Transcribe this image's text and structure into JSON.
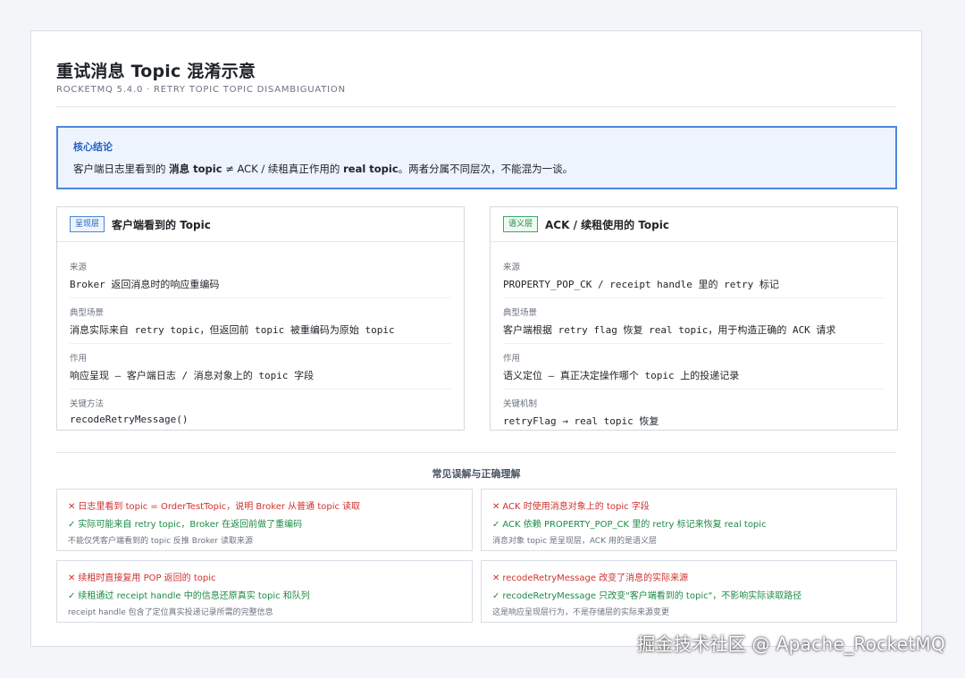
{
  "header": {
    "title": "重试消息 Topic 混淆示意",
    "subtitle": "ROCKETMQ 5.4.0 · RETRY TOPIC TOPIC DISAMBIGUATION"
  },
  "conclusion": {
    "title": "核心结论",
    "text_1": "客户端日志里看到的 ",
    "bold_1": "消息 topic",
    "text_2": " ≠ ACK / 续租真正作用的 ",
    "bold_2": "real topic",
    "text_3": "。两者分属不同层次，不能混为一谈。"
  },
  "layers": [
    {
      "tag": "呈现层",
      "title": "客户端看到的 Topic",
      "fields": [
        {
          "label": "来源",
          "value": "Broker 返回消息时的响应重编码"
        },
        {
          "label": "典型场景",
          "value": "消息实际来自 retry topic，但返回前 topic 被重编码为原始 topic"
        },
        {
          "label": "作用",
          "value": "响应呈现 — 客户端日志 / 消息对象上的 topic 字段"
        },
        {
          "label": "关键方法",
          "value": "recodeRetryMessage()"
        }
      ]
    },
    {
      "tag": "语义层",
      "title": "ACK / 续租使用的 Topic",
      "fields": [
        {
          "label": "来源",
          "value": "PROPERTY_POP_CK / receipt handle 里的 retry 标记"
        },
        {
          "label": "典型场景",
          "value": "客户端根据 retry flag 恢复 real topic，用于构造正确的 ACK 请求"
        },
        {
          "label": "作用",
          "value": "语义定位 — 真正决定操作哪个 topic 上的投递记录"
        },
        {
          "label": "关键机制",
          "value": "retryFlag → real topic 恢复"
        }
      ]
    }
  ],
  "misconceptions_title": "常见误解与正确理解",
  "misconceptions": [
    {
      "wrong": "日志里看到 topic = OrderTestTopic，说明 Broker 从普通 topic 读取",
      "right": "实际可能来自 retry topic，Broker 在返回前做了重编码",
      "note": "不能仅凭客户端看到的 topic 反推 Broker 读取来源"
    },
    {
      "wrong": "ACK 时使用消息对象上的 topic 字段",
      "right": "ACK 依赖 PROPERTY_POP_CK 里的 retry 标记来恢复 real topic",
      "note": "消息对象 topic 是呈现层，ACK 用的是语义层"
    },
    {
      "wrong": "续租时直接复用 POP 返回的 topic",
      "right": "续租通过 receipt handle 中的信息还原真实 topic 和队列",
      "note": "receipt handle 包含了定位真实投递记录所需的完整信息"
    },
    {
      "wrong": "recodeRetryMessage 改变了消息的实际来源",
      "right": "recodeRetryMessage 只改变\"客户端看到的 topic\"，不影响实际读取路径",
      "note": "这是响应呈现层行为，不是存储层的实际来源变更"
    }
  ],
  "marks": {
    "wrong": "✕",
    "right": "✓"
  },
  "watermark": "掘金技术社区 @ Apache_RocketMQ"
}
